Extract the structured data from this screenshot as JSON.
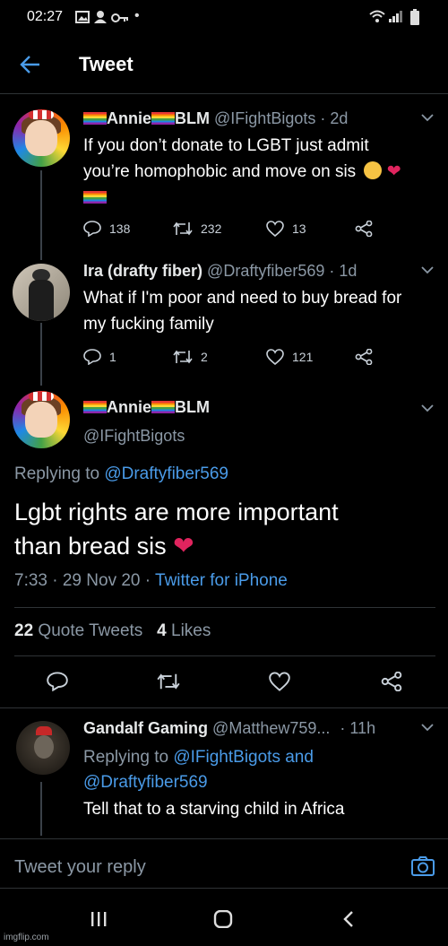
{
  "status_bar": {
    "time": "02:27",
    "dot": "•"
  },
  "header": {
    "title": "Tweet"
  },
  "tweet1": {
    "name_prefix": "Annie",
    "name_suffix": "BLM",
    "handle": "@IFightBigots",
    "time": "· 2d",
    "text_line1": "If you don’t donate to LGBT just admit",
    "text_line2": "you’re homophobic and move on sis",
    "replies": "138",
    "retweets": "232",
    "likes": "13"
  },
  "tweet2": {
    "name": "Ira (drafty fiber)",
    "handle": "@Draftyfiber569",
    "time": "· 1d",
    "text_line1": "What if I'm poor and need to buy bread for",
    "text_line2": "my fucking family",
    "replies": "1",
    "retweets": "2",
    "likes": "121"
  },
  "main_tweet": {
    "name_prefix": "Annie",
    "name_suffix": "BLM",
    "handle": "@IFightBigots",
    "replying_label": "Replying to",
    "replying_handle": "@Draftyfiber569",
    "text_line1": "Lgbt rights are more important",
    "text_line2": "than bread sis",
    "timestamp": "7:33 · 29 Nov 20 · ",
    "client": "Twitter for iPhone",
    "quote_count": "22",
    "quote_label": "Quote Tweets",
    "like_count": "4",
    "like_label": "Likes"
  },
  "reply": {
    "name": "Gandalf Gaming",
    "handle": "@Matthew759...",
    "time": "· 11h",
    "replying_label": "Replying to",
    "replying_handles_line1": "@IFightBigots and",
    "replying_handles_line2": "@Draftyfiber569",
    "text": "Tell that to a starving child in Africa"
  },
  "composer": {
    "placeholder": "Tweet your reply"
  },
  "watermark": "imgflip.com",
  "colors": {
    "background": "#000000",
    "accent": "#4a9be8",
    "heart": "#e0245e",
    "muted": "#8b98a5"
  }
}
